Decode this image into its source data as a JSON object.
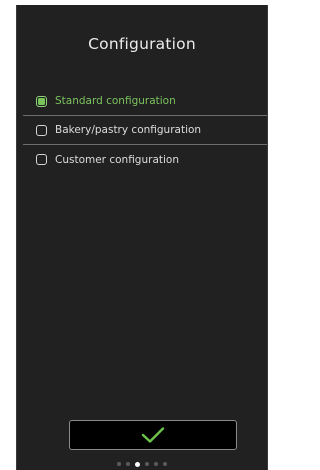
{
  "screen": {
    "title": "Configuration"
  },
  "options": [
    {
      "label": "Standard configuration",
      "selected": true
    },
    {
      "label": "Bakery/pastry configuration",
      "selected": false
    },
    {
      "label": "Customer configuration",
      "selected": false
    }
  ],
  "confirm": {
    "icon": "checkmark-icon",
    "color": "#6cc24a"
  },
  "pager": {
    "total": 6,
    "current": 3
  },
  "colors": {
    "background": "#212121",
    "accent": "#7cc25e"
  }
}
